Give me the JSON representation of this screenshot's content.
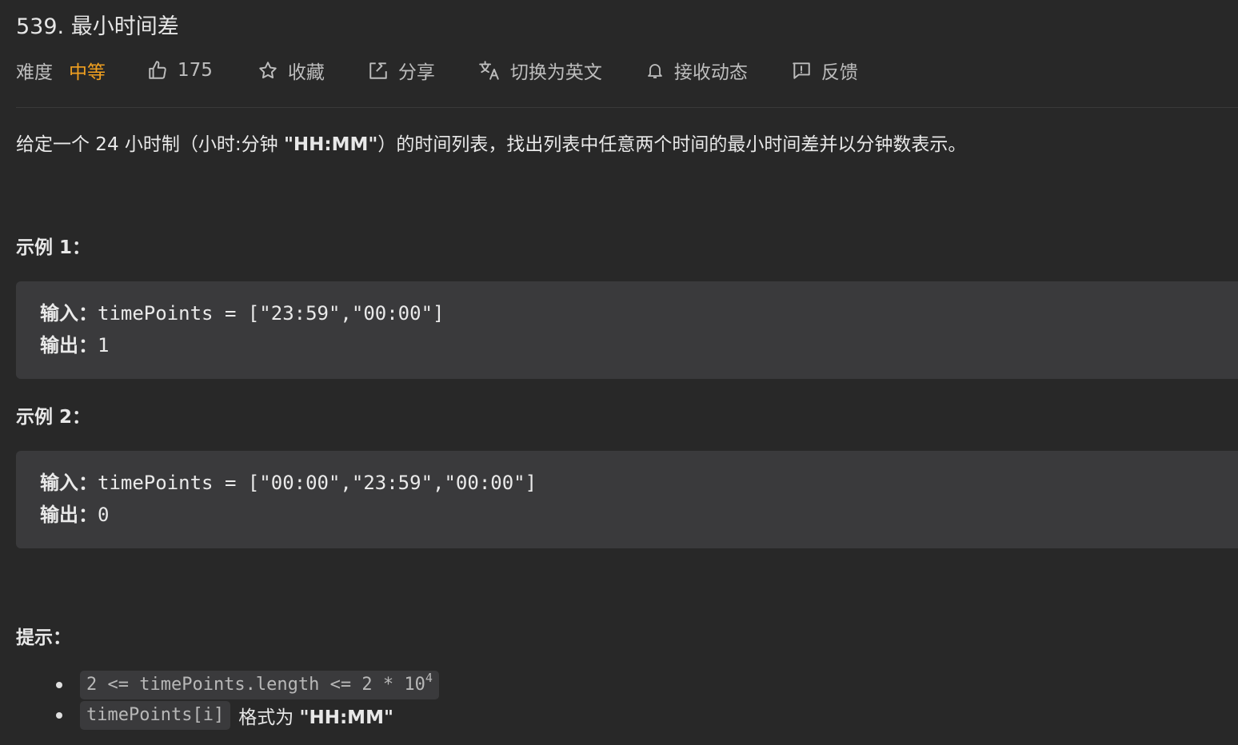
{
  "problem": {
    "title": "539. 最小时间差"
  },
  "toolbar": {
    "difficulty_label": "难度",
    "difficulty_value": "中等",
    "difficulty_color": "#f0a020",
    "likes": "175",
    "favorite_label": "收藏",
    "share_label": "分享",
    "translate_label": "切换为英文",
    "subscribe_label": "接收动态",
    "feedback_label": "反馈",
    "icons": [
      "thumbs-up-icon",
      "star-icon",
      "share-icon",
      "translate-icon",
      "bell-icon",
      "feedback-icon"
    ]
  },
  "description": {
    "prefix": "给定一个 24 小时制（小时:分钟 ",
    "format": "\"HH:MM\"",
    "suffix": "）的时间列表，找出列表中任意两个时间的最小时间差并以分钟数表示。"
  },
  "examples": [
    {
      "heading": "示例 1：",
      "input_label": "输入：",
      "input_value": "timePoints = [\"23:59\",\"00:00\"]",
      "output_label": "输出：",
      "output_value": "1"
    },
    {
      "heading": "示例 2：",
      "input_label": "输入：",
      "input_value": "timePoints = [\"00:00\",\"23:59\",\"00:00\"]",
      "output_label": "输出：",
      "output_value": "0"
    }
  ],
  "hints": {
    "heading": "提示：",
    "constraint1_code": "2 <= timePoints.length <= 2 * 10",
    "constraint1_exp": "4",
    "constraint2_code": "timePoints[i]",
    "constraint2_text": "格式为 ",
    "constraint2_format": "\"HH:MM\""
  }
}
